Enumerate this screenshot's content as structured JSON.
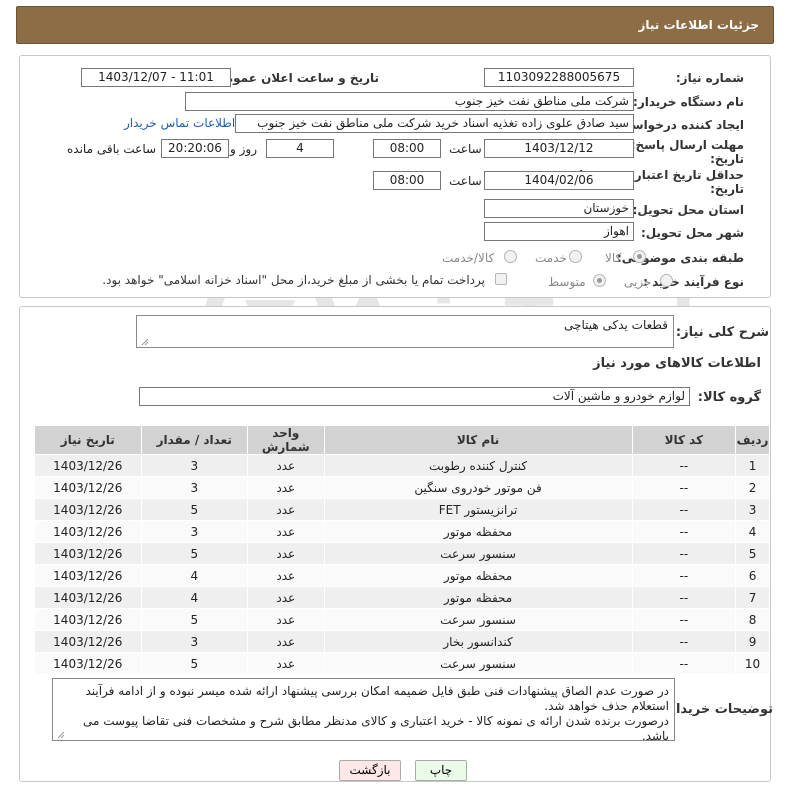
{
  "header": {
    "title": "جزئیات اطلاعات نیاز"
  },
  "form": {
    "need_number": {
      "label": "شماره نیاز:",
      "value": "1103092288005675"
    },
    "announce_datetime": {
      "label": "تاریخ و ساعت اعلان عمومی:",
      "value": "1403/12/07 - 11:01"
    },
    "buyer_org": {
      "label": "نام دستگاه خریدار:",
      "value": "شرکت ملی مناطق نفت خیز جنوب"
    },
    "requester": {
      "label": "ایجاد کننده درخواست:",
      "value": "سید صادق علوی زاده  تغذیه اسناد خرید  شرکت ملی مناطق نفت خیز جنوب",
      "contact_link": "اطلاعات تماس خریدار"
    },
    "reply_deadline": {
      "label_line1": "مهلت ارسال پاسخ: تا",
      "label_line2": "تاریخ:",
      "date": "1403/12/12",
      "time_label": "ساعت",
      "time": "08:00",
      "days": "4",
      "days_label": "روز و",
      "remaining": "20:20:06",
      "remaining_label": "ساعت باقی مانده"
    },
    "price_validity": {
      "label_line1": "حداقل تاریخ اعتبار قیمت: تا",
      "label_line2": "تاریخ:",
      "date": "1404/02/06",
      "time_label": "ساعت",
      "time": "08:00"
    },
    "province": {
      "label": "استان محل تحویل:",
      "value": "خوزستان"
    },
    "city": {
      "label": "شهر محل تحویل:",
      "value": "اهواز"
    },
    "category": {
      "label": "طبقه بندی موضوعی:",
      "options": [
        "کالا",
        "خدمت",
        "کالا/خدمت"
      ],
      "selected": "کالا"
    },
    "purchase_process": {
      "label": "نوع فرآیند خرید :",
      "options": [
        "جزیی",
        "متوسط"
      ],
      "selected": "متوسط",
      "treasury_note": "پرداخت تمام یا بخشی از مبلغ خرید،از محل \"اسناد خزانه اسلامی\" خواهد بود."
    }
  },
  "description": {
    "label": "شرح کلی نیاز:",
    "value": "قطعات یدکی هیتاچی"
  },
  "goods_info_title": "اطلاعات کالاهای مورد نیاز",
  "goods_group": {
    "label": "گروه کالا:",
    "value": "لوازم خودرو و ماشین آلات"
  },
  "table": {
    "headers": [
      "ردیف",
      "کد کالا",
      "نام کالا",
      "واحد شمارش",
      "تعداد / مقدار",
      "تاریخ نیاز"
    ],
    "rows": [
      [
        "1",
        "--",
        "کنترل کننده رطوبت",
        "عدد",
        "3",
        "1403/12/26"
      ],
      [
        "2",
        "--",
        "فن موتور خودروی سنگین",
        "عدد",
        "3",
        "1403/12/26"
      ],
      [
        "3",
        "--",
        "ترانزیستور FET",
        "عدد",
        "5",
        "1403/12/26"
      ],
      [
        "4",
        "--",
        "محفظه موتور",
        "عدد",
        "3",
        "1403/12/26"
      ],
      [
        "5",
        "--",
        "سنسور سرعت",
        "عدد",
        "5",
        "1403/12/26"
      ],
      [
        "6",
        "--",
        "محفظه موتور",
        "عدد",
        "4",
        "1403/12/26"
      ],
      [
        "7",
        "--",
        "محفظه موتور",
        "عدد",
        "4",
        "1403/12/26"
      ],
      [
        "8",
        "--",
        "سنسور سرعت",
        "عدد",
        "5",
        "1403/12/26"
      ],
      [
        "9",
        "--",
        "کندانسور بخار",
        "عدد",
        "3",
        "1403/12/26"
      ],
      [
        "10",
        "--",
        "سنسور سرعت",
        "عدد",
        "5",
        "1403/12/26"
      ]
    ]
  },
  "buyer_notes": {
    "label": "توضیحات خریدار:",
    "lines": [
      "در صورت عدم الصاق پیشنهادات فنی طبق فایل ضمیمه امکان بررسی پیشنهاد ارائه شده میسر نبوده و از ادامه فرآیند استعلام حذف خواهد شد.",
      "درصورت برنده شدن ارائه ی نمونه کالا - خرید اعتباری و کالای مدنظر مطابق شرح و مشخصات فنی تقاضا پیوست می باشد."
    ]
  },
  "buttons": {
    "print": "چاپ",
    "back": "بازگشت"
  },
  "watermark": {
    "text": "AriaTender.net"
  },
  "colors": {
    "header_bg": "#8c6d46",
    "table_header": "#d2d2d2",
    "link": "#1f5fb0",
    "back_btn": "#fde7e7",
    "print_btn": "#eafbe8"
  }
}
